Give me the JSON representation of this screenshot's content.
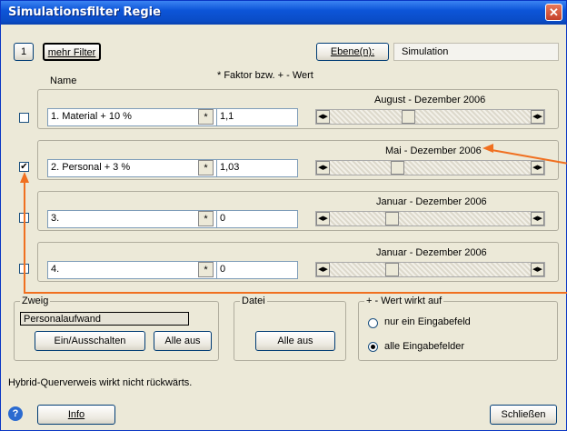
{
  "window": {
    "title": "Simulationsfilter Regie",
    "close_glyph": "✕"
  },
  "toolbar": {
    "filter_index": "1",
    "more_filter_label": "mehr Filter",
    "levels_label": "Ebene(n):",
    "levels_value": "Simulation"
  },
  "columns": {
    "name": "Name",
    "factor": "* Faktor bzw. + - Wert"
  },
  "rows": [
    {
      "checked": false,
      "name": "1. Material + 10 %",
      "op": "*",
      "value": "1,1",
      "period": "August - Dezember 2006"
    },
    {
      "checked": true,
      "name": "2. Personal + 3 %",
      "op": "*",
      "value": "1,03",
      "period": "Mai - Dezember 2006"
    },
    {
      "checked": false,
      "name": "3.",
      "op": "*",
      "value": "0",
      "period": "Januar - Dezember 2006"
    },
    {
      "checked": false,
      "name": "4.",
      "op": "*",
      "value": "0",
      "period": "Januar - Dezember 2006"
    }
  ],
  "zweig": {
    "label": "Zweig",
    "value": "Personalaufwand",
    "toggle_label": "Ein/Ausschalten",
    "all_off_label": "Alle aus"
  },
  "datei": {
    "label": "Datei",
    "all_off_label": "Alle aus"
  },
  "wert": {
    "label": "+ - Wert wirkt auf",
    "option1": "nur ein Eingabefeld",
    "option2": "alle Eingabefelder",
    "selected": 2
  },
  "status_text": "Hybrid-Querverweis wirkt nicht rückwärts.",
  "footer": {
    "help_glyph": "?",
    "info_label": "Info",
    "close_label": "Schließen"
  },
  "colors": {
    "title_bar": "#0d55d8",
    "annotation_arrow": "#f07020",
    "close_button": "#c4402a"
  }
}
